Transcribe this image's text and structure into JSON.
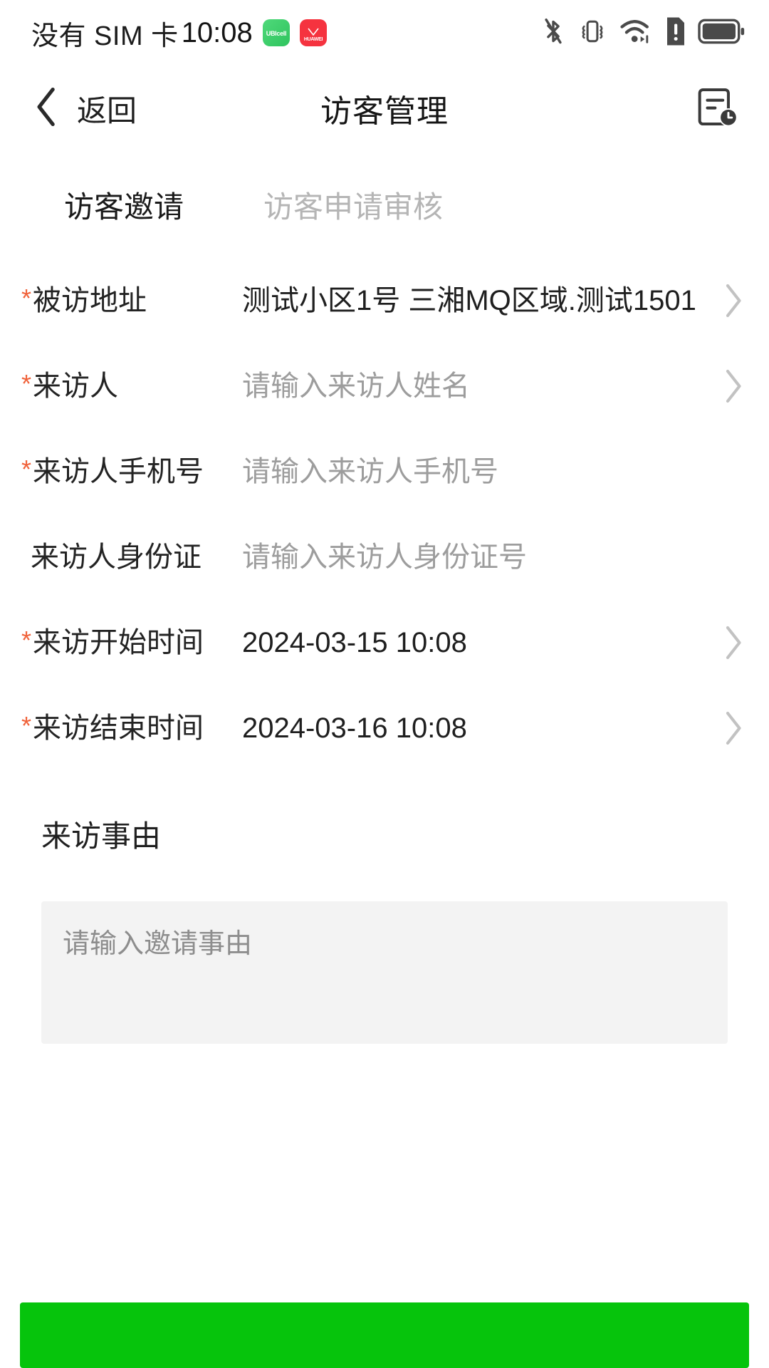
{
  "status_bar": {
    "carrier": "没有 SIM 卡",
    "clock": "10:08",
    "app_badges": [
      {
        "name": "ubicell-app-icon",
        "label": "UBIcell",
        "color": "#2fc45e"
      },
      {
        "name": "huawei-app-icon",
        "label": "HUAWEI",
        "color": "#f5333f"
      }
    ],
    "icons": [
      "bluetooth-off-icon",
      "vibrate-icon",
      "wifi-icon",
      "sim-alert-icon",
      "battery-full-icon"
    ]
  },
  "nav": {
    "back_label": "返回",
    "title": "访客管理",
    "action_icon": "visit-record-history-icon"
  },
  "tabs": [
    {
      "label": "访客邀请",
      "active": true
    },
    {
      "label": "访客申请审核",
      "active": false
    }
  ],
  "form": {
    "rows": [
      {
        "label": "被访地址",
        "required": true,
        "value": "测试小区1号 三湘MQ区域.测试1501",
        "is_placeholder": false,
        "chevron": true
      },
      {
        "label": "来访人",
        "required": true,
        "value": "请输入来访人姓名",
        "is_placeholder": true,
        "chevron": true
      },
      {
        "label": "来访人手机号",
        "required": true,
        "value": "请输入来访人手机号",
        "is_placeholder": true,
        "chevron": false
      },
      {
        "label": "来访人身份证",
        "required": false,
        "value": "请输入来访人身份证号",
        "is_placeholder": true,
        "chevron": false
      },
      {
        "label": "来访开始时间",
        "required": true,
        "value": "2024-03-15 10:08",
        "is_placeholder": false,
        "chevron": true
      },
      {
        "label": "来访结束时间",
        "required": true,
        "value": "2024-03-16 10:08",
        "is_placeholder": false,
        "chevron": true
      }
    ]
  },
  "reason": {
    "title": "来访事由",
    "placeholder": "请输入邀请事由",
    "value": ""
  },
  "submit": {
    "label": "",
    "color": "#06c40c"
  },
  "colors": {
    "required_asterisk": "#f0623a",
    "active_tab": "#1a1a1a",
    "inactive_tab": "#b5b5b5",
    "placeholder_text": "#9d9d9d",
    "value_text": "#1f1f1f",
    "submit_green": "#06c40c",
    "textarea_bg": "#f3f3f3"
  }
}
